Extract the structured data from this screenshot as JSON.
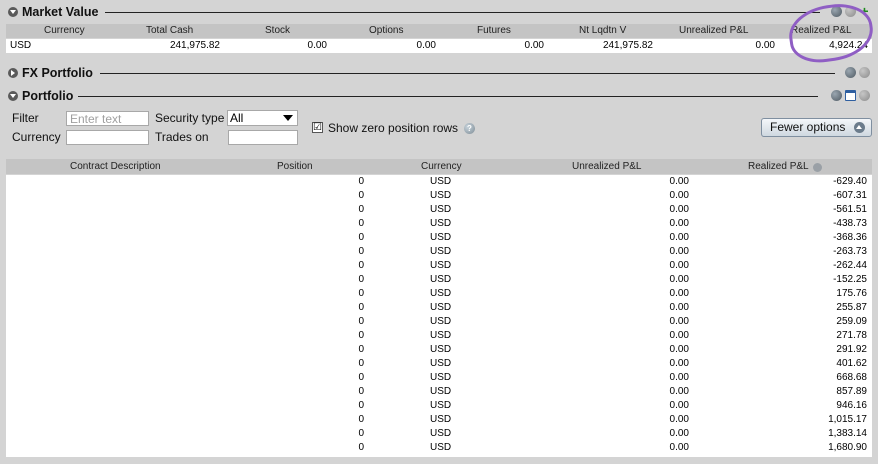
{
  "market_value": {
    "title": "Market Value",
    "columns": [
      "Currency",
      "Total Cash",
      "Stock",
      "Options",
      "Futures",
      "Nt Lqdtn V",
      "Unrealized P&L",
      "Realized P&L"
    ],
    "row": [
      "USD",
      "241,975.82",
      "0.00",
      "0.00",
      "0.00",
      "241,975.82",
      "0.00",
      "4,924.24"
    ],
    "annotation_color": "#8f5ec4"
  },
  "fx_portfolio": {
    "title": "FX Portfolio"
  },
  "portfolio": {
    "title": "Portfolio",
    "filter_label": "Filter",
    "filter_placeholder": "Enter text",
    "security_type_label": "Security type",
    "security_type_value": "All",
    "currency_label": "Currency",
    "trades_on_label": "Trades on",
    "show_zero_label": "Show zero position rows",
    "show_zero_checked": "☑",
    "fewer_options_label": "Fewer options",
    "columns": [
      "Contract Description",
      "Position",
      "Currency",
      "Unrealized P&L",
      "Realized P&L"
    ],
    "rows": [
      {
        "position": "0",
        "currency": "USD",
        "unrealized": "0.00",
        "realized": "-629.40"
      },
      {
        "position": "0",
        "currency": "USD",
        "unrealized": "0.00",
        "realized": "-607.31"
      },
      {
        "position": "0",
        "currency": "USD",
        "unrealized": "0.00",
        "realized": "-561.51"
      },
      {
        "position": "0",
        "currency": "USD",
        "unrealized": "0.00",
        "realized": "-438.73"
      },
      {
        "position": "0",
        "currency": "USD",
        "unrealized": "0.00",
        "realized": "-368.36"
      },
      {
        "position": "0",
        "currency": "USD",
        "unrealized": "0.00",
        "realized": "-263.73"
      },
      {
        "position": "0",
        "currency": "USD",
        "unrealized": "0.00",
        "realized": "-262.44"
      },
      {
        "position": "0",
        "currency": "USD",
        "unrealized": "0.00",
        "realized": "-152.25"
      },
      {
        "position": "0",
        "currency": "USD",
        "unrealized": "0.00",
        "realized": "175.76"
      },
      {
        "position": "0",
        "currency": "USD",
        "unrealized": "0.00",
        "realized": "255.87"
      },
      {
        "position": "0",
        "currency": "USD",
        "unrealized": "0.00",
        "realized": "259.09"
      },
      {
        "position": "0",
        "currency": "USD",
        "unrealized": "0.00",
        "realized": "271.78"
      },
      {
        "position": "0",
        "currency": "USD",
        "unrealized": "0.00",
        "realized": "291.92"
      },
      {
        "position": "0",
        "currency": "USD",
        "unrealized": "0.00",
        "realized": "401.62"
      },
      {
        "position": "0",
        "currency": "USD",
        "unrealized": "0.00",
        "realized": "668.68"
      },
      {
        "position": "0",
        "currency": "USD",
        "unrealized": "0.00",
        "realized": "857.89"
      },
      {
        "position": "0",
        "currency": "USD",
        "unrealized": "0.00",
        "realized": "946.16"
      },
      {
        "position": "0",
        "currency": "USD",
        "unrealized": "0.00",
        "realized": "1,015.17"
      },
      {
        "position": "0",
        "currency": "USD",
        "unrealized": "0.00",
        "realized": "1,383.14"
      },
      {
        "position": "0",
        "currency": "USD",
        "unrealized": "0.00",
        "realized": "1,680.90"
      }
    ]
  },
  "icons": {
    "section_toggle": "chevron-icon",
    "refresh": "refresh-icon",
    "config": "gear-icon",
    "add": "plus-icon",
    "detach": "window-icon",
    "help": "help-icon",
    "sort": "sort-icon"
  }
}
